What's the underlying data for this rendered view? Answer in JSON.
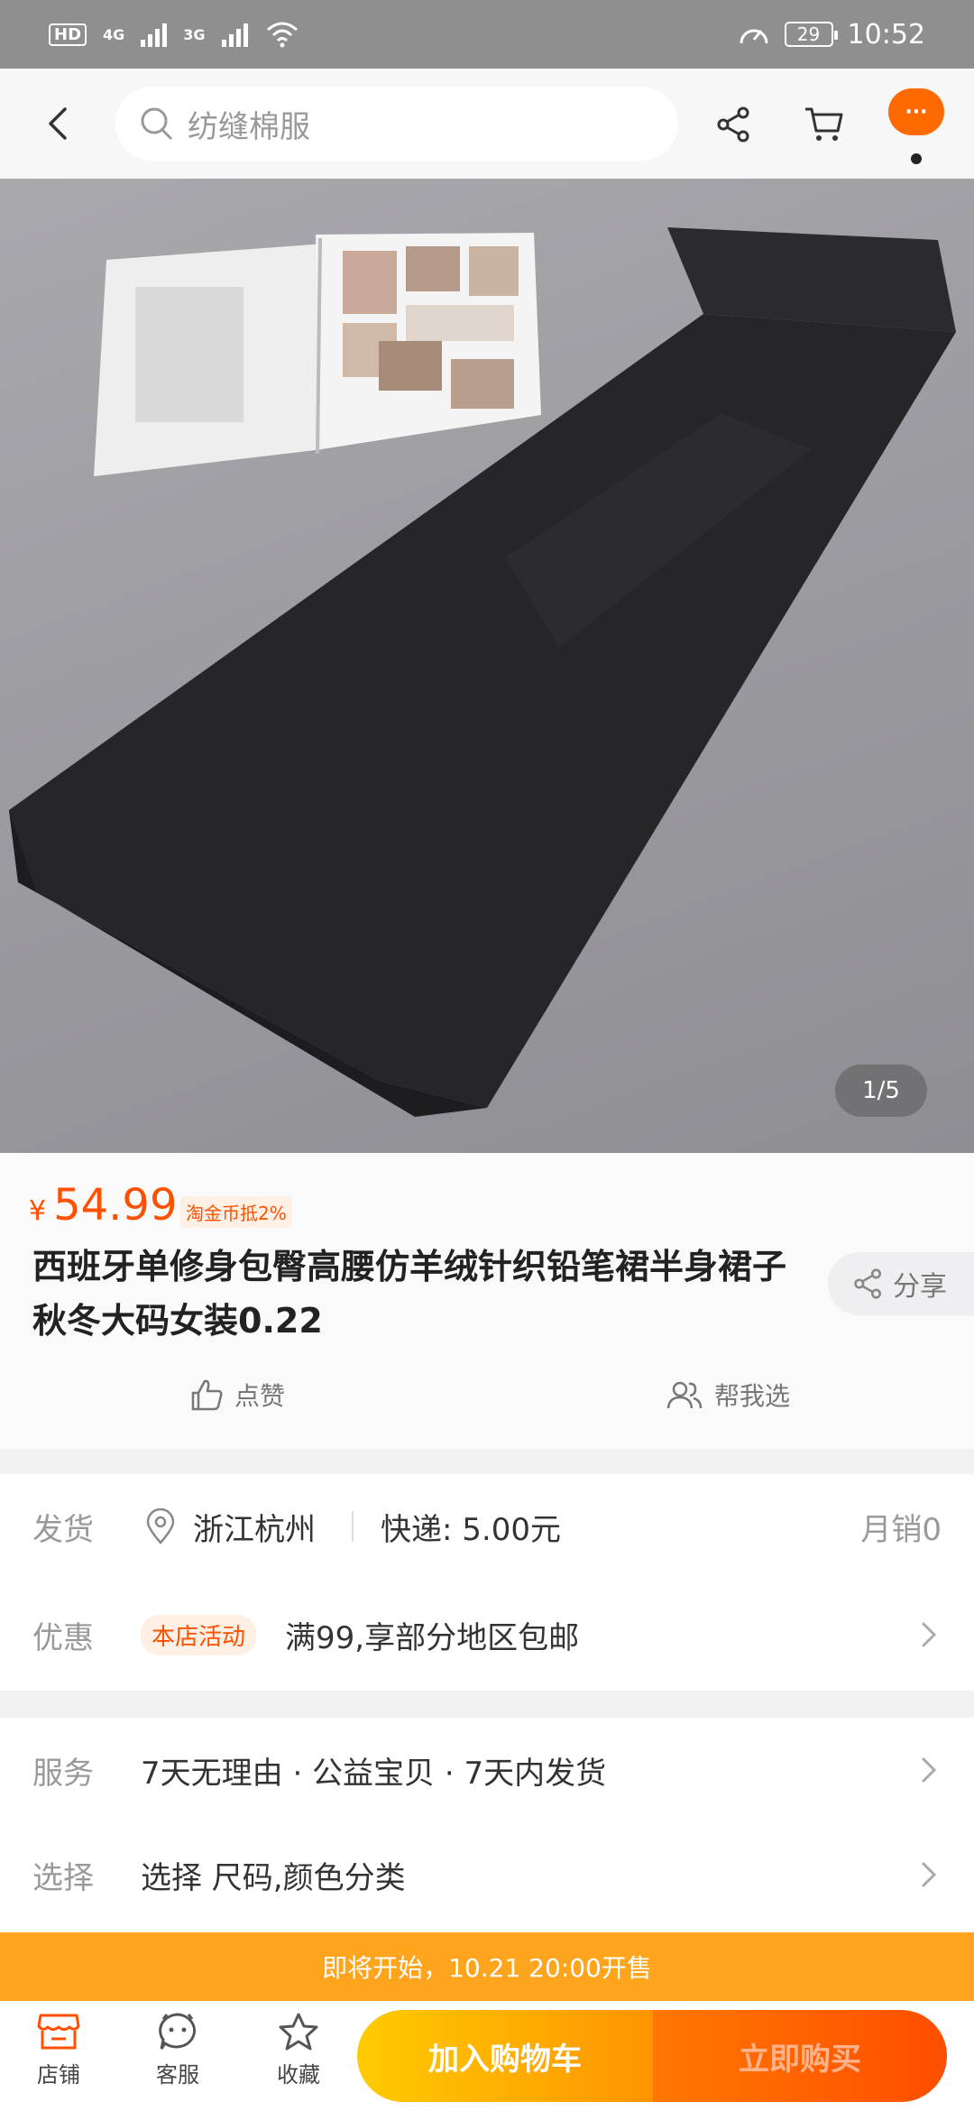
{
  "status_bar": {
    "hd": "HD",
    "sim1": "4G",
    "sim2": "3G",
    "battery": "29",
    "time": "10:52"
  },
  "top_nav": {
    "search_placeholder": "纺缝棉服",
    "more_label": "···",
    "icons": [
      "back-icon",
      "search-icon",
      "share-icon",
      "cart-icon",
      "more-icon"
    ]
  },
  "gallery": {
    "counter": "1/5",
    "image_subject": "black knit pencil skirt on grey carpet with magazine"
  },
  "product": {
    "price_symbol": "¥",
    "price": "54.99",
    "coin_tag": "淘金币抵2%",
    "title": "西班牙单修身包臀高腰仿羊绒针织铅笔裙半身裙子秋冬大码女装0.22",
    "share_label": "分享",
    "like_label": "点赞",
    "help_choose_label": "帮我选"
  },
  "shipping": {
    "label": "发货",
    "location": "浙江杭州",
    "express": "快递: 5.00元",
    "monthly_sales": "月销0"
  },
  "promotion": {
    "label": "优惠",
    "tag": "本店活动",
    "text": "满99,享部分地区包邮"
  },
  "service": {
    "label": "服务",
    "text": "7天无理由 · 公益宝贝 · 7天内发货"
  },
  "selection": {
    "label": "选择",
    "text": "选择 尺码,颜色分类"
  },
  "sale_banner": {
    "text": "即将开始，10.21 20:00开售"
  },
  "bottom_bar": {
    "store": "店铺",
    "service": "客服",
    "favorite": "收藏",
    "add_to_cart": "加入购物车",
    "buy_now": "立即购买"
  },
  "colors": {
    "accent": "#ff5000",
    "banner": "#ffa41d",
    "cart_gradient_start": "#ffcb00",
    "buy_gradient_end": "#ff4e00"
  }
}
